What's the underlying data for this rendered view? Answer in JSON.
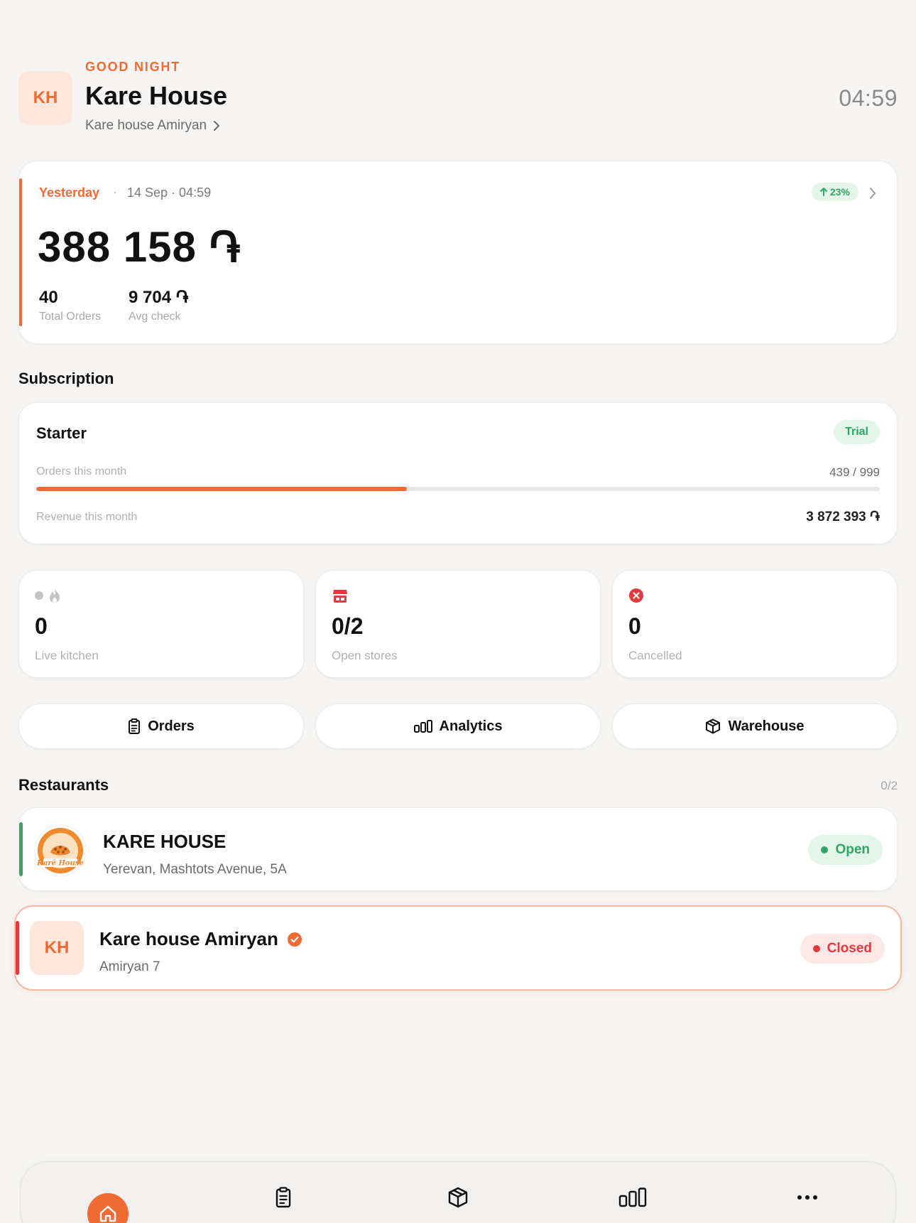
{
  "header": {
    "avatar_initials": "KH",
    "greeting": "GOOD NIGHT",
    "brand_name": "Kare House",
    "branch_name": "Kare house Amiryan",
    "clock": "04:59"
  },
  "sales_summary": {
    "period": "Yesterday",
    "separator": "·",
    "date": "14 Sep · 04:59",
    "trend": "23%",
    "total": "388 158 ֏",
    "metrics": [
      {
        "value": "40",
        "label": "Total Orders"
      },
      {
        "value": "9 704 ֏",
        "label": "Avg check"
      }
    ]
  },
  "subscription": {
    "section_title": "Subscription",
    "plan": "Starter",
    "badge": "Trial",
    "orders_label": "Orders this month",
    "orders_value": "439 / 999",
    "orders_used": 439,
    "orders_limit": 999,
    "revenue_label": "Revenue this month",
    "revenue_value": "3 872 393 ֏"
  },
  "stats": [
    {
      "value": "0",
      "label": "Live kitchen",
      "icon": "flame-icon"
    },
    {
      "value": "0/2",
      "label": "Open stores",
      "icon": "store-icon"
    },
    {
      "value": "0",
      "label": "Cancelled",
      "icon": "cancel-icon"
    }
  ],
  "actions": [
    {
      "label": "Orders",
      "icon": "clipboard-icon"
    },
    {
      "label": "Analytics",
      "icon": "bar-chart-icon"
    },
    {
      "label": "Warehouse",
      "icon": "box-icon"
    }
  ],
  "restaurants": {
    "section_title": "Restaurants",
    "count": "0/2",
    "items": [
      {
        "name": "KARE HOUSE",
        "address": "Yerevan, Mashtots Avenue, 5A",
        "status": "Open",
        "logo_text": "Karē House"
      },
      {
        "name": "Kare house Amiryan",
        "address": "Amiryan 7",
        "status": "Closed",
        "avatar_initials": "KH"
      }
    ]
  },
  "tabbar": {
    "items": [
      "home-icon",
      "clipboard-icon",
      "box-icon",
      "bar-chart-icon",
      "more-icon"
    ]
  },
  "colors": {
    "accent": "#f06a34",
    "success": "#2fa662",
    "danger": "#e5393e",
    "background": "#f6f5f3"
  }
}
